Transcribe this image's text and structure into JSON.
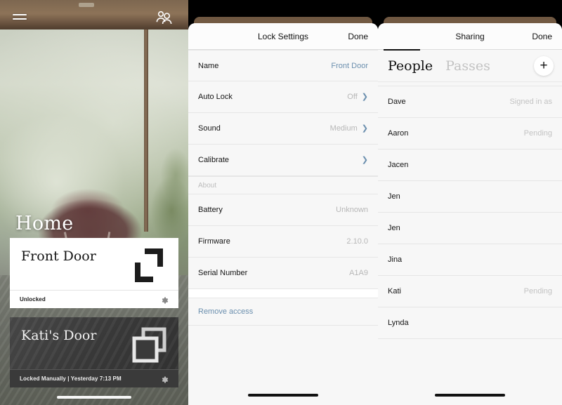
{
  "home": {
    "menu_icon": "hamburger-menu-icon",
    "people_icon": "two-people-icon",
    "title": "Home",
    "locks": [
      {
        "name": "Front Door",
        "state": "Unlocked",
        "status_text": "Unlocked",
        "glyph": "unlocked-bracket-icon",
        "settings_icon": "gear-icon"
      },
      {
        "name": "Kati's Door",
        "state": "Locked",
        "status_text": "Locked Manually | Yesterday  7:13 PM",
        "glyph": "locked-square-icon",
        "settings_icon": "gear-icon"
      }
    ]
  },
  "lock_settings": {
    "nav": {
      "title": "Lock Settings",
      "done_label": "Done"
    },
    "rows": [
      {
        "label": "Name",
        "value": "Front Door",
        "accent": true,
        "chevron": false
      },
      {
        "label": "Auto Lock",
        "value": "Off",
        "accent": false,
        "chevron": true
      },
      {
        "label": "Sound",
        "value": "Medium",
        "accent": false,
        "chevron": true
      },
      {
        "label": "Calibrate",
        "value": "",
        "accent": false,
        "chevron": true
      }
    ],
    "section_about": "About",
    "about_rows": [
      {
        "label": "Battery",
        "value": "Unknown"
      },
      {
        "label": "Firmware",
        "value": "2.10.0"
      },
      {
        "label": "Serial Number",
        "value": "A1A9"
      }
    ],
    "remove_access_label": "Remove access"
  },
  "sharing": {
    "nav": {
      "title": "Sharing",
      "done_label": "Done"
    },
    "tabs": [
      {
        "label": "People",
        "active": true
      },
      {
        "label": "Passes",
        "active": false
      }
    ],
    "add_icon": "plus-icon",
    "people": [
      {
        "name": "Dave",
        "status": "Signed in as"
      },
      {
        "name": "Aaron",
        "status": "Pending"
      },
      {
        "name": "Jacen",
        "status": ""
      },
      {
        "name": "Jen",
        "status": ""
      },
      {
        "name": "Jen",
        "status": ""
      },
      {
        "name": "Jina",
        "status": ""
      },
      {
        "name": "Kati",
        "status": "Pending"
      },
      {
        "name": "Lynda",
        "status": ""
      }
    ]
  },
  "colors": {
    "accent_blue": "#6b8fae",
    "sheet_bg": "#f7f7f7",
    "text_primary": "#141414",
    "text_muted": "#b7b7b7"
  }
}
